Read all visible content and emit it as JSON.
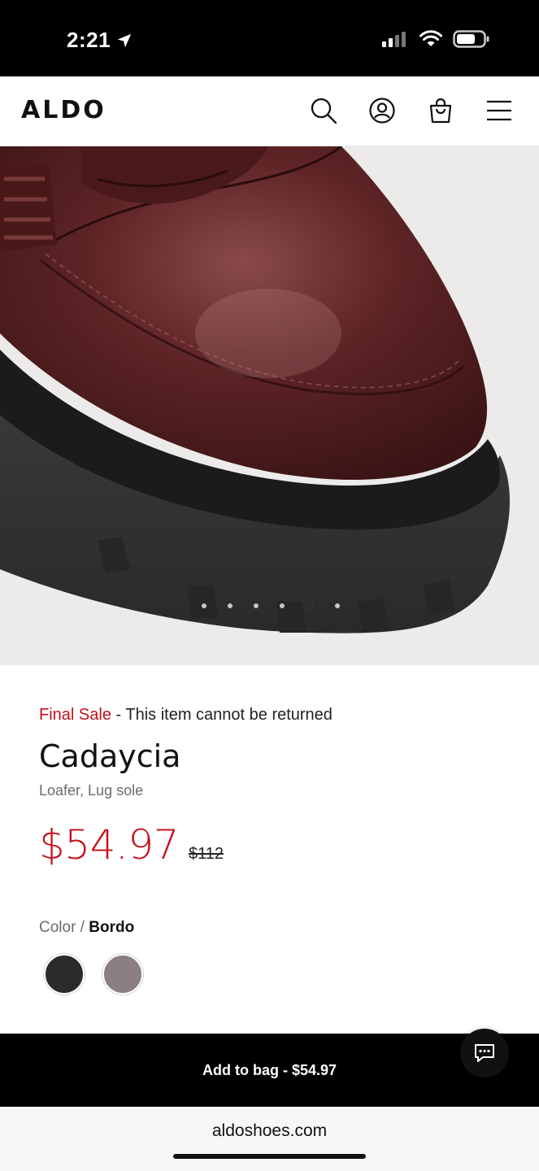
{
  "status_bar": {
    "time": "2:21"
  },
  "header": {
    "logo": "ALDO"
  },
  "icons": {
    "location": "location-arrow-icon",
    "signal": "signal-icon",
    "wifi": "wifi-icon",
    "battery": "battery-icon",
    "search": "search-icon",
    "account": "account-icon",
    "bag": "shopping-bag-icon",
    "menu": "hamburger-menu-icon",
    "chat": "chat-icon"
  },
  "gallery": {
    "dot_count": 6,
    "active_index": 4
  },
  "product": {
    "final_sale_label": "Final Sale",
    "final_sale_note": " - This item cannot be returned",
    "name": "Cadaycia",
    "subtitle": "Loafer, Lug sole",
    "price": "$54.97",
    "original_price": "$112"
  },
  "color": {
    "label": "Color",
    "separator": " / ",
    "selected": "Bordo",
    "swatch_colors": [
      "#2b2b2b",
      "#8c7f82"
    ]
  },
  "add_to_bag": {
    "label": "Add to bag - $54.97"
  },
  "browser": {
    "url": "aldoshoes.com"
  },
  "colors": {
    "accent_red": "#c4121b",
    "background_image": "#ecebea"
  }
}
